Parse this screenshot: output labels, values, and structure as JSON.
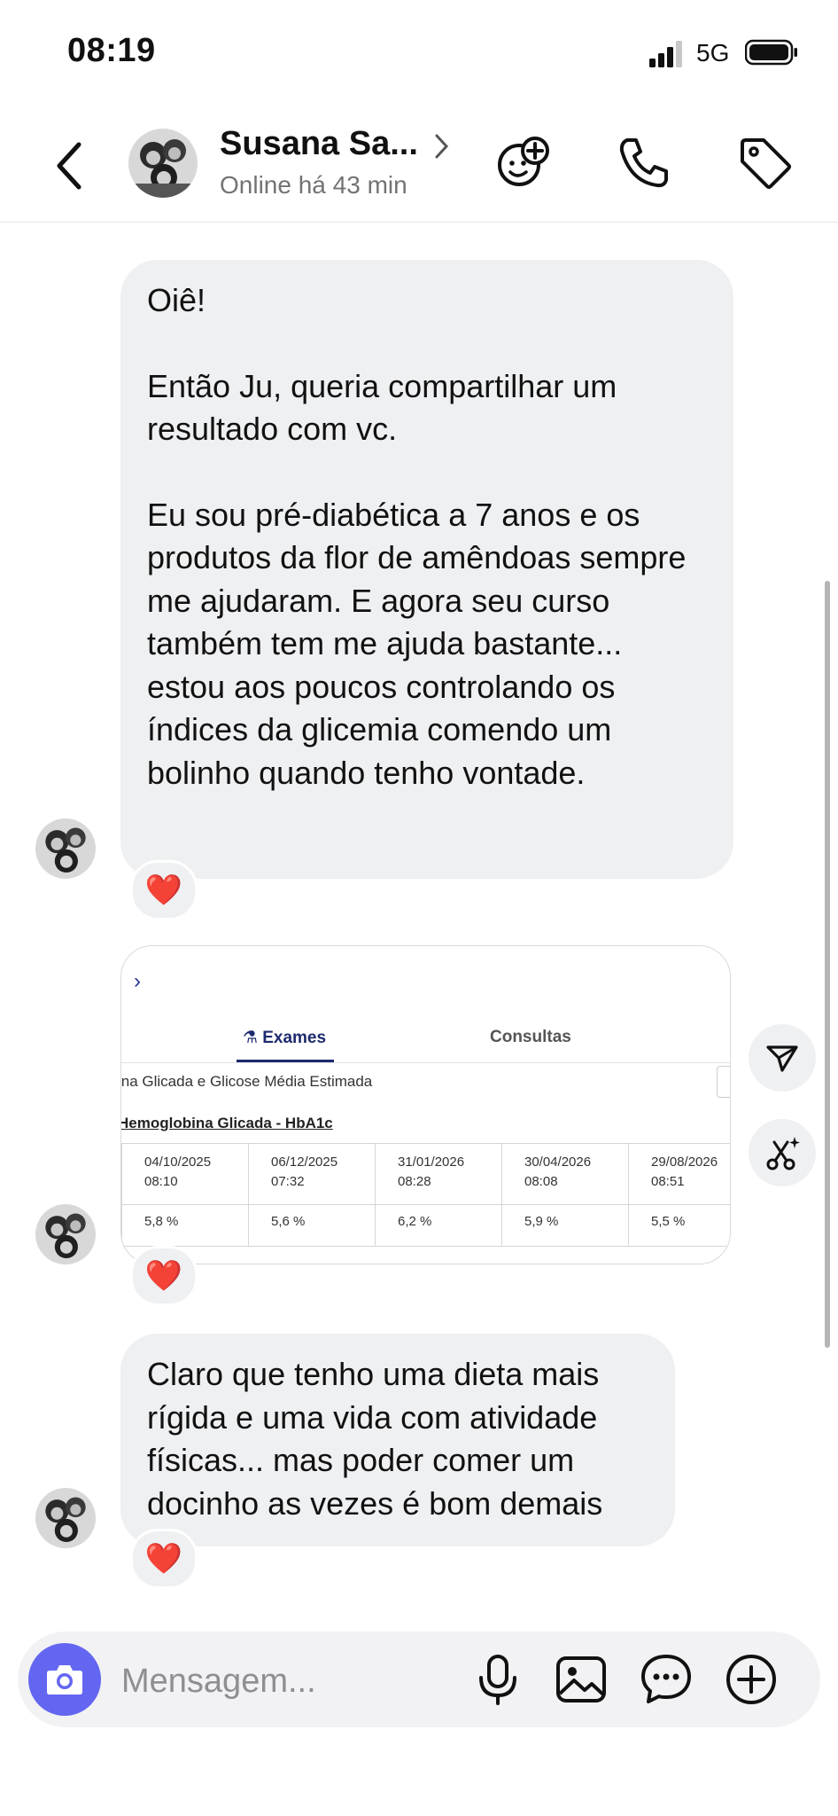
{
  "status_bar": {
    "time": "08:19",
    "network": "5G"
  },
  "header": {
    "contact_name": "Susana Sa...",
    "contact_status": "Online há 43 min",
    "icons": [
      "back-icon",
      "stickers-icon",
      "phone-icon",
      "tag-icon"
    ]
  },
  "messages": [
    {
      "type": "text",
      "paragraphs": [
        "Oiê!",
        "Então Ju, queria compartilhar um resultado com vc.",
        "Eu sou pré-diabética a 7 anos e os produtos da flor de amêndoas sempre me ajudaram. E agora seu curso também tem me ajuda bastante... estou aos poucos controlando os índices da glicemia comendo um bolinho quando tenho vontade."
      ],
      "reaction": "❤️"
    },
    {
      "type": "image",
      "reaction": "❤️",
      "image": {
        "tab_active": "Exames",
        "tab_other": "Consultas",
        "subtitle": "ina Glicada e Glicose Média Estimada",
        "test_name": "Hemoglobina Glicada - HbA1c",
        "columns": [
          {
            "date": "04/10/2025",
            "time": "08:10",
            "value": "5,8 %"
          },
          {
            "date": "06/12/2025",
            "time": "07:32",
            "value": "5,6 %"
          },
          {
            "date": "31/01/2026",
            "time": "08:28",
            "value": "6,2 %"
          },
          {
            "date": "30/04/2026",
            "time": "08:08",
            "value": "5,9 %"
          },
          {
            "date": "29/08/2026",
            "time": "08:51",
            "value": "5,5 %"
          }
        ]
      }
    },
    {
      "type": "text",
      "text": "Claro que tenho uma dieta mais rígida e uma vida com atividade físicas... mas poder comer um docinho as vezes é bom demais",
      "reaction": "❤️"
    }
  ],
  "composer": {
    "placeholder": "Mensagem..."
  },
  "colors": {
    "bubble": "#eff0f2",
    "accent": "#6366f1",
    "heart": "#ed1c35"
  }
}
